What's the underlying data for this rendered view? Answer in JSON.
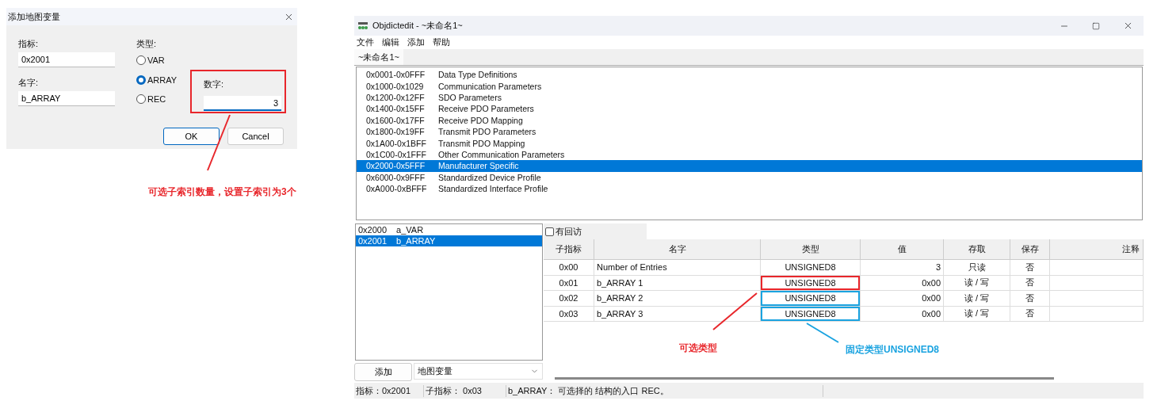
{
  "dialog": {
    "title": "添加地图变量",
    "fields": [
      {
        "label": "指标:",
        "value": "0x2001"
      },
      {
        "label": "名字:",
        "value": "b_ARRAY"
      }
    ],
    "type_label": "类型:",
    "types": [
      {
        "label": "VAR",
        "selected": false
      },
      {
        "label": "ARRAY",
        "selected": true
      },
      {
        "label": "REC",
        "selected": false
      }
    ],
    "count": {
      "label": "数字:",
      "value": "3"
    },
    "buttons": [
      {
        "label": "OK",
        "default": true
      },
      {
        "label": "Cancel",
        "default": false
      }
    ]
  },
  "annotations": [
    {
      "text": "可选子索引数量，设置子索引为3个",
      "color": "#e8262b"
    },
    {
      "text": "可选类型",
      "color": "#e8262b"
    },
    {
      "text": "固定类型UNSIGNED8",
      "color": "#1aa3e0"
    }
  ],
  "window": {
    "title": "Objdictedit - ~未命名1~"
  },
  "menu": [
    "文件",
    "编辑",
    "添加",
    "帮助"
  ],
  "tabs": [
    {
      "label": "~未命名1~",
      "selected": true
    }
  ],
  "ranges": [
    {
      "range": "0x0001-0x0FFF",
      "name": "Data Type Definitions",
      "selected": false
    },
    {
      "range": "0x1000-0x1029",
      "name": "Communication Parameters",
      "selected": false
    },
    {
      "range": "0x1200-0x12FF",
      "name": "SDO Parameters",
      "selected": false
    },
    {
      "range": "0x1400-0x15FF",
      "name": "Receive PDO Parameters",
      "selected": false
    },
    {
      "range": "0x1600-0x17FF",
      "name": "Receive PDO Mapping",
      "selected": false
    },
    {
      "range": "0x1800-0x19FF",
      "name": "Transmit PDO Parameters",
      "selected": false
    },
    {
      "range": "0x1A00-0x1BFF",
      "name": "Transmit PDO Mapping",
      "selected": false
    },
    {
      "range": "0x1C00-0x1FFF",
      "name": "Other Communication Parameters",
      "selected": false
    },
    {
      "range": "0x2000-0x5FFF",
      "name": "Manufacturer Specific",
      "selected": true
    },
    {
      "range": "0x6000-0x9FFF",
      "name": "Standardized Device Profile",
      "selected": false
    },
    {
      "range": "0xA000-0xBFFF",
      "name": "Standardized Interface Profile",
      "selected": false
    }
  ],
  "entries": [
    {
      "index": "0x2000",
      "name": "a_VAR",
      "selected": false
    },
    {
      "index": "0x2001",
      "name": "b_ARRAY",
      "selected": true
    }
  ],
  "add_button": "添加",
  "entry_kind": "地图变量",
  "callback": {
    "label": "有回访",
    "checked": false
  },
  "table": {
    "columns": [
      "子指标",
      "名字",
      "类型",
      "值",
      "存取",
      "保存",
      "注释"
    ],
    "rows": [
      {
        "cells": [
          "0x00",
          "Number of Entries",
          "UNSIGNED8",
          "3",
          "只读",
          "否"
        ],
        "kind": "plain"
      },
      {
        "cells": [
          "0x01",
          "b_ARRAY 1",
          "UNSIGNED8",
          "0x00",
          "读 / 写",
          "否"
        ],
        "kind": "framed",
        "color": "#e8262b"
      },
      {
        "cells": [
          "0x02",
          "b_ARRAY 2",
          "UNSIGNED8",
          "0x00",
          "读 / 写",
          "否"
        ],
        "kind": "framed",
        "color": "#1aa3e0"
      },
      {
        "cells": [
          "0x03",
          "b_ARRAY 3",
          "UNSIGNED8",
          "0x00",
          "读 / 写",
          "否"
        ],
        "kind": "framed",
        "color": "#1aa3e0"
      }
    ]
  },
  "status_bar": [
    "指标：0x2001",
    "子指标： 0x03",
    "b_ARRAY： 可选择的 结构的入口 REC。"
  ]
}
